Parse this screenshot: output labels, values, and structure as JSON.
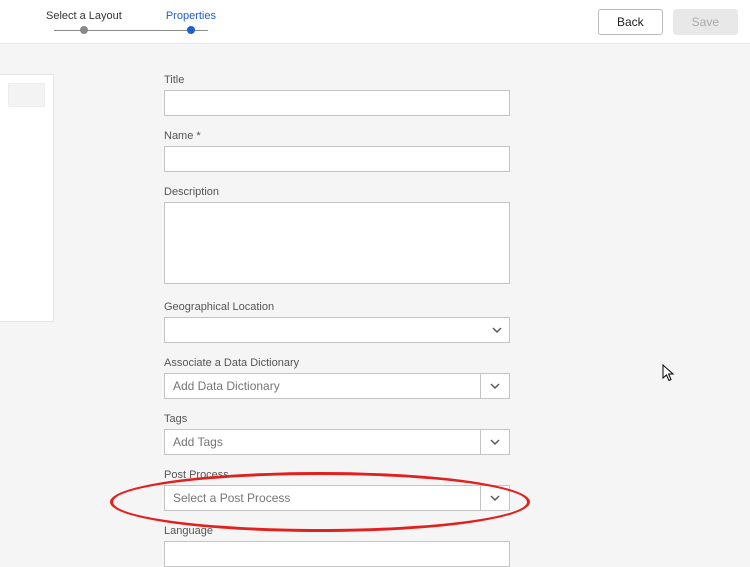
{
  "steps": {
    "step1": "Select a Layout",
    "step2": "Properties"
  },
  "actions": {
    "back": "Back",
    "save": "Save"
  },
  "form": {
    "title_label": "Title",
    "title_value": "",
    "name_label": "Name *",
    "name_value": "",
    "description_label": "Description",
    "description_value": "",
    "geo_label": "Geographical Location",
    "geo_value": "",
    "dict_label": "Associate a Data Dictionary",
    "dict_placeholder": "Add Data Dictionary",
    "tags_label": "Tags",
    "tags_placeholder": "Add Tags",
    "post_label": "Post Process",
    "post_placeholder": "Select a Post Process",
    "lang_label": "Language",
    "lang_value": ""
  }
}
